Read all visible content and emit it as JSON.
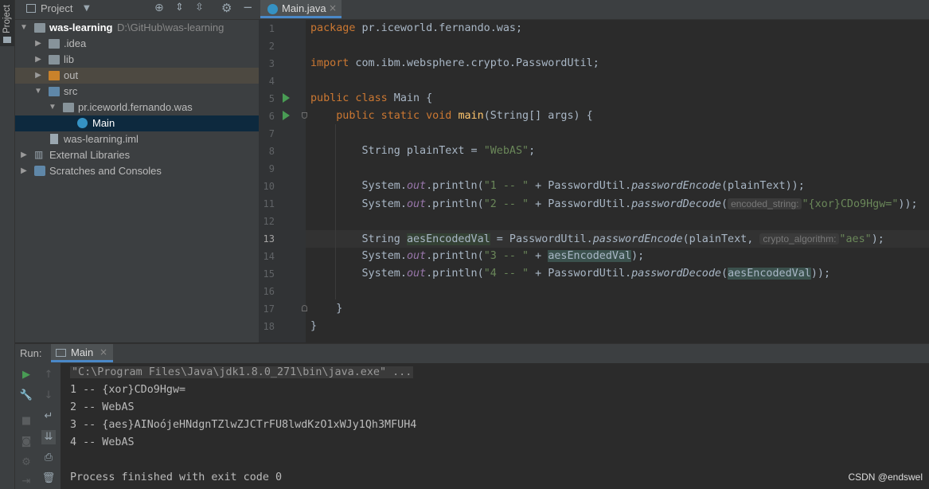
{
  "sidebar": {
    "tab_label": "Project"
  },
  "project_panel": {
    "title": "Project",
    "tree": [
      {
        "label": "was-learning",
        "path": "D:\\GitHub\\was-learning"
      },
      {
        "label": ".idea"
      },
      {
        "label": "lib"
      },
      {
        "label": "out"
      },
      {
        "label": "src"
      },
      {
        "label": "pr.iceworld.fernando.was"
      },
      {
        "label": "Main"
      },
      {
        "label": "was-learning.iml"
      },
      {
        "label": "External Libraries"
      },
      {
        "label": "Scratches and Consoles"
      }
    ]
  },
  "editor": {
    "tab_label": "Main.java",
    "line_numbers": [
      "1",
      "2",
      "3",
      "4",
      "5",
      "6",
      "7",
      "8",
      "9",
      "10",
      "11",
      "12",
      "13",
      "14",
      "15",
      "16",
      "17",
      "18"
    ],
    "code": {
      "l1": {
        "kw": "package",
        "rest": " pr.iceworld.fernando.was;"
      },
      "l3": {
        "kw": "import",
        "rest": " com.ibm.websphere.crypto.PasswordUtil;"
      },
      "l5": {
        "kw": "public class",
        "name": " Main {"
      },
      "l6": {
        "kw": "public static void",
        "method": "main",
        "rest": "(String[] args) {"
      },
      "l8": {
        "pre": "String plainText = ",
        "str": "\"WebAS\"",
        "post": ";"
      },
      "l10": {
        "pre": "System.",
        "field": "out",
        "mid": ".println(",
        "str": "\"1 -- \"",
        "mid2": " + PasswordUtil.",
        "call": "passwordEncode",
        "post": "(plainText));"
      },
      "l11": {
        "pre": "System.",
        "field": "out",
        "mid": ".println(",
        "str": "\"2 -- \"",
        "mid2": " + PasswordUtil.",
        "call": "passwordDecode",
        "open": "(",
        "hint": "encoded_string:",
        "str2": "\"{xor}CDo9Hgw=\"",
        "post": "));"
      },
      "l13": {
        "pre": "String ",
        "var": "aesEncodedVal",
        "mid": " = PasswordUtil.",
        "call": "passwordEncode",
        "mid2": "(plainText, ",
        "hint": "crypto_algorithm:",
        "str": "\"aes\"",
        "post": ");"
      },
      "l14": {
        "pre": "System.",
        "field": "out",
        "mid": ".println(",
        "str": "\"3 -- \"",
        "mid2": " + ",
        "var": "aesEncodedVal",
        "post": ");"
      },
      "l15": {
        "pre": "System.",
        "field": "out",
        "mid": ".println(",
        "str": "\"4 -- \"",
        "mid2": " + PasswordUtil.",
        "call": "passwordDecode",
        "open": "(",
        "var": "aesEncodedVal",
        "post": "));"
      },
      "l17": "}",
      "l18": "}"
    }
  },
  "run_panel": {
    "label": "Run:",
    "tab_label": "Main",
    "console": {
      "command": "\"C:\\Program Files\\Java\\jdk1.8.0_271\\bin\\java.exe\" ...",
      "lines": [
        "1 -- {xor}CDo9Hgw=",
        "2 -- WebAS",
        "3 -- {aes}AINoójeHNdgnTZlwZJCTrFU8lwdKzO1xWJy1Qh3MFUH4",
        "4 -- WebAS"
      ],
      "exit": "Process finished with exit code 0"
    }
  },
  "watermark": "CSDN @endswel",
  "colors": {
    "background": "#2b2b2b",
    "panel": "#3c3f41",
    "keyword": "#cc7832",
    "string": "#6a8759",
    "field": "#9876aa",
    "method": "#ffc66d",
    "accent": "#4a88c7"
  }
}
